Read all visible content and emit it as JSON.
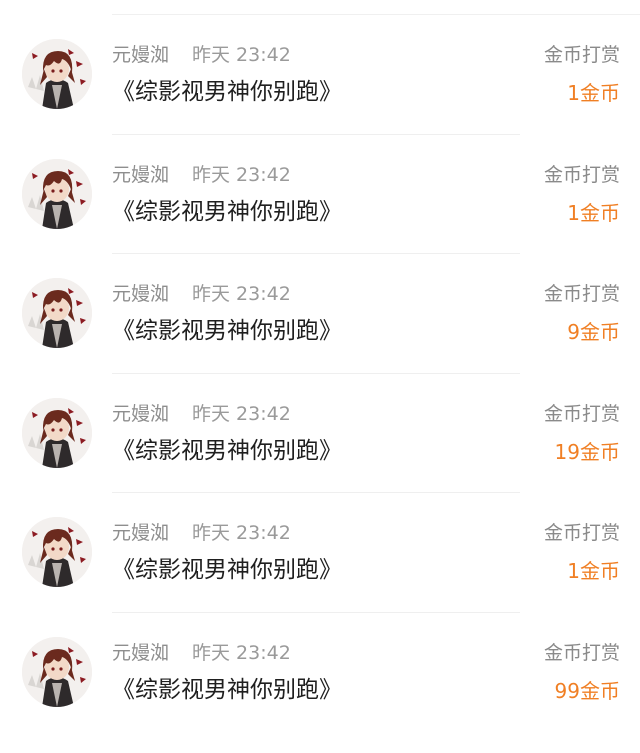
{
  "rows": [
    {
      "user": "元嫚洳",
      "time": "昨天 23:42",
      "book": "《综影视男神你别跑》",
      "reward_type": "金币打赏",
      "amount": "1金币"
    },
    {
      "user": "元嫚洳",
      "time": "昨天 23:42",
      "book": "《综影视男神你别跑》",
      "reward_type": "金币打赏",
      "amount": "1金币"
    },
    {
      "user": "元嫚洳",
      "time": "昨天 23:42",
      "book": "《综影视男神你别跑》",
      "reward_type": "金币打赏",
      "amount": "9金币"
    },
    {
      "user": "元嫚洳",
      "time": "昨天 23:42",
      "book": "《综影视男神你别跑》",
      "reward_type": "金币打赏",
      "amount": "19金币"
    },
    {
      "user": "元嫚洳",
      "time": "昨天 23:42",
      "book": "《综影视男神你别跑》",
      "reward_type": "金币打赏",
      "amount": "1金币"
    },
    {
      "user": "元嫚洳",
      "time": "昨天 23:42",
      "book": "《综影视男神你别跑》",
      "reward_type": "金币打赏",
      "amount": "99金币"
    }
  ],
  "colors": {
    "amount": "#f07f24",
    "title": "#1f1f1f",
    "meta": "#8e8e8e"
  },
  "icons": {
    "avatar": "anime-character-avatar-icon"
  }
}
